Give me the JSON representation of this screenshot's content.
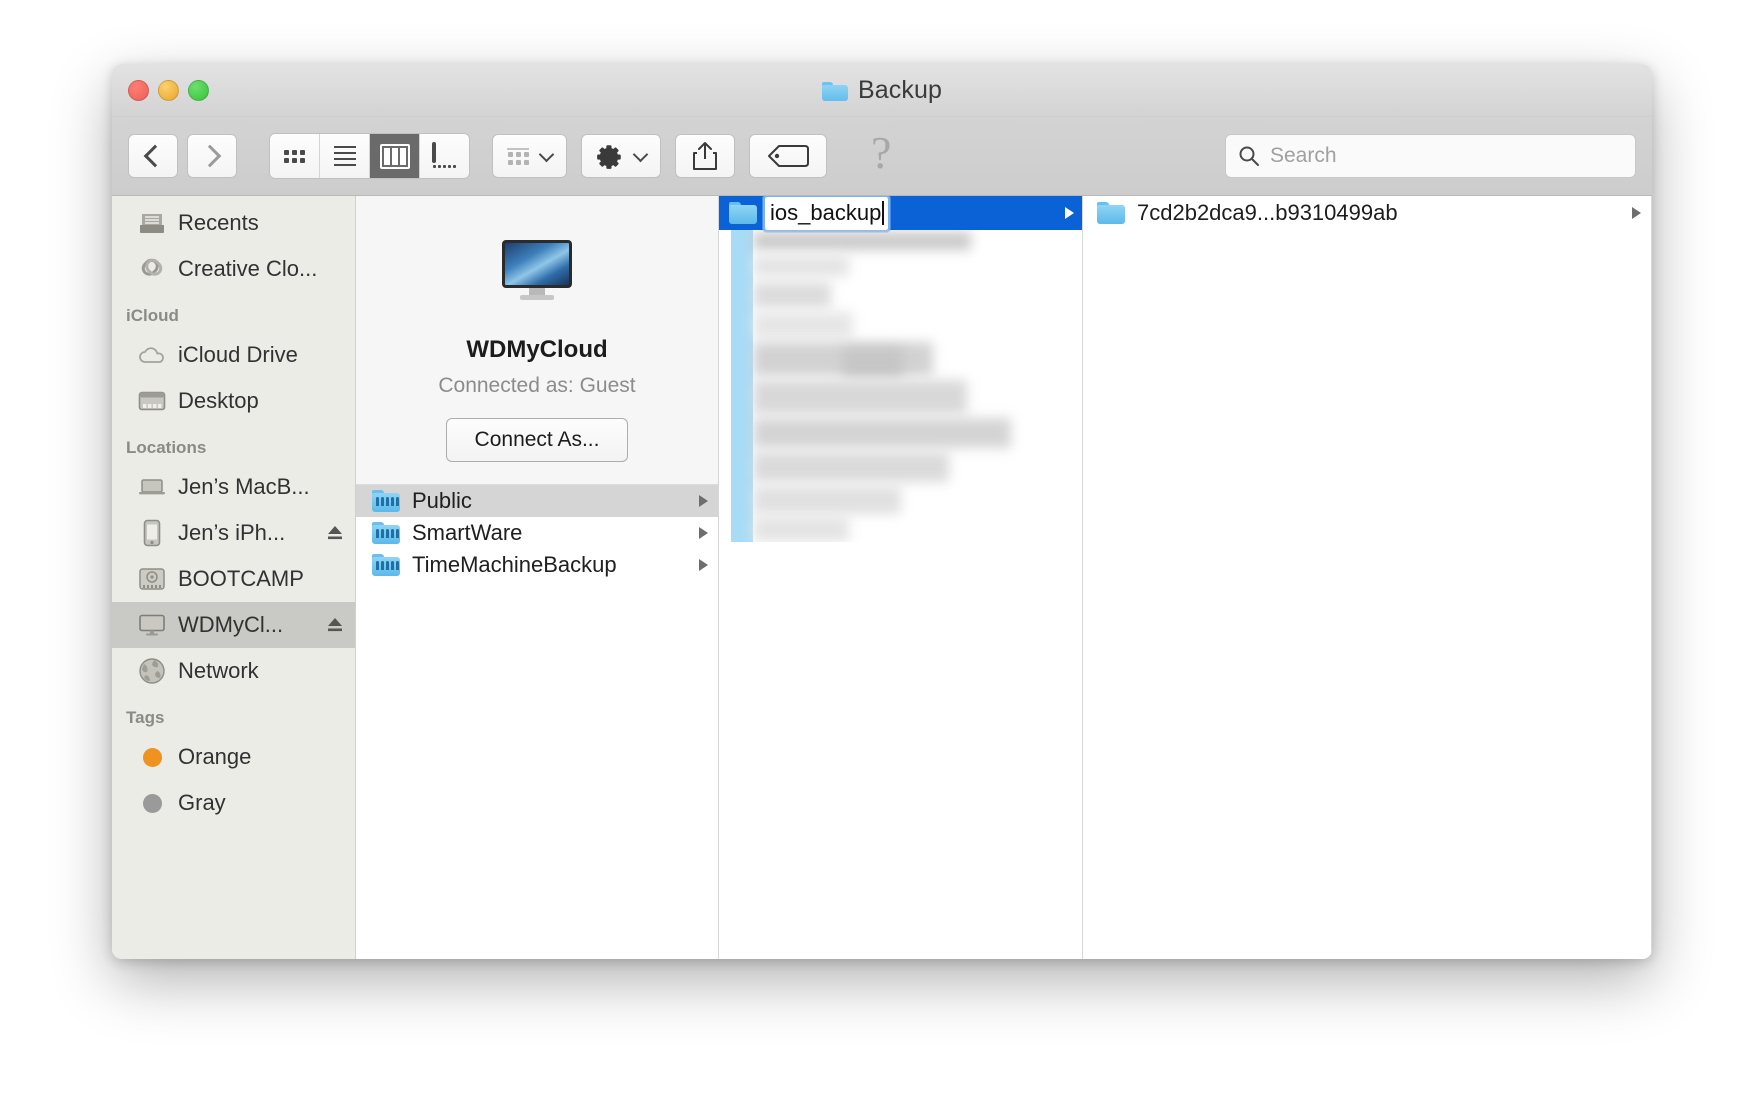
{
  "window": {
    "title": "Backup",
    "title_icon": "folder-icon",
    "traffic_lights": [
      {
        "name": "close-button",
        "color": "#ec5f55"
      },
      {
        "name": "minimize-button",
        "color": "#e5a62b"
      },
      {
        "name": "maximize-button",
        "color": "#35c23a"
      }
    ]
  },
  "toolbar": {
    "back_icon": "chevron-left-icon",
    "forward_icon": "chevron-right-icon",
    "view_modes": [
      {
        "name": "icon-view",
        "icon": "grid-icon",
        "active": false
      },
      {
        "name": "list-view",
        "icon": "list-icon",
        "active": false
      },
      {
        "name": "column-view",
        "icon": "columns-icon",
        "active": true
      },
      {
        "name": "gallery-view",
        "icon": "gallery-icon",
        "active": false
      }
    ],
    "group_by_icon": "group-grid-icon",
    "group_by_caret": "chevron-down-icon",
    "action_icon": "gear-icon",
    "action_caret": "chevron-down-icon",
    "share_icon": "share-icon",
    "tag_icon": "tag-icon",
    "help_icon": "question-mark-icon",
    "help_glyph": "?"
  },
  "search": {
    "icon": "search-icon",
    "placeholder": "Search",
    "value": ""
  },
  "sidebar": {
    "groups": [
      {
        "header": null,
        "items": [
          {
            "label": "Recents",
            "icon": "recents-icon",
            "eject": false,
            "selected": false
          },
          {
            "label": "Creative Clo...",
            "icon": "creative-cloud-icon",
            "eject": false,
            "selected": false
          }
        ]
      },
      {
        "header": "iCloud",
        "items": [
          {
            "label": "iCloud Drive",
            "icon": "icloud-icon",
            "eject": false,
            "selected": false
          },
          {
            "label": "Desktop",
            "icon": "desktop-folder-icon",
            "eject": false,
            "selected": false
          }
        ]
      },
      {
        "header": "Locations",
        "items": [
          {
            "label": "Jen’s MacB...",
            "icon": "laptop-icon",
            "eject": false,
            "selected": false
          },
          {
            "label": "Jen’s iPh...",
            "icon": "iphone-icon",
            "eject": true,
            "selected": false
          },
          {
            "label": "BOOTCAMP",
            "icon": "harddrive-icon",
            "eject": false,
            "selected": false
          },
          {
            "label": "WDMyCl...",
            "icon": "display-icon",
            "eject": true,
            "selected": true
          },
          {
            "label": "Network",
            "icon": "globe-icon",
            "eject": false,
            "selected": false
          }
        ]
      },
      {
        "header": "Tags",
        "items": [
          {
            "label": "Orange",
            "icon": "tag-dot-icon",
            "color": "#f0921f",
            "eject": false,
            "selected": false
          },
          {
            "label": "Gray",
            "icon": "tag-dot-icon",
            "color": "#9a9a9a",
            "eject": false,
            "selected": false
          }
        ]
      }
    ]
  },
  "server_column": {
    "icon": "server-display-icon",
    "name": "WDMyCloud",
    "status": "Connected as: Guest",
    "connect_button": "Connect As...",
    "shares": [
      {
        "label": "Public",
        "icon": "shared-folder-icon",
        "selected": true,
        "disclosure": true
      },
      {
        "label": "SmartWare",
        "icon": "shared-folder-icon",
        "selected": false,
        "disclosure": true
      },
      {
        "label": "TimeMachineBackup",
        "icon": "shared-folder-icon",
        "selected": false,
        "disclosure": true
      }
    ]
  },
  "backup_column": {
    "renaming_row": {
      "icon": "folder-icon",
      "value": "ios_backup",
      "selected": true,
      "disclosure": true,
      "editing": true
    },
    "redacted_note": "blurred folder listing"
  },
  "detail_column": {
    "rows": [
      {
        "label": "7cd2b2dca9...b9310499ab",
        "icon": "folder-icon",
        "disclosure": true,
        "selected": false
      }
    ]
  }
}
